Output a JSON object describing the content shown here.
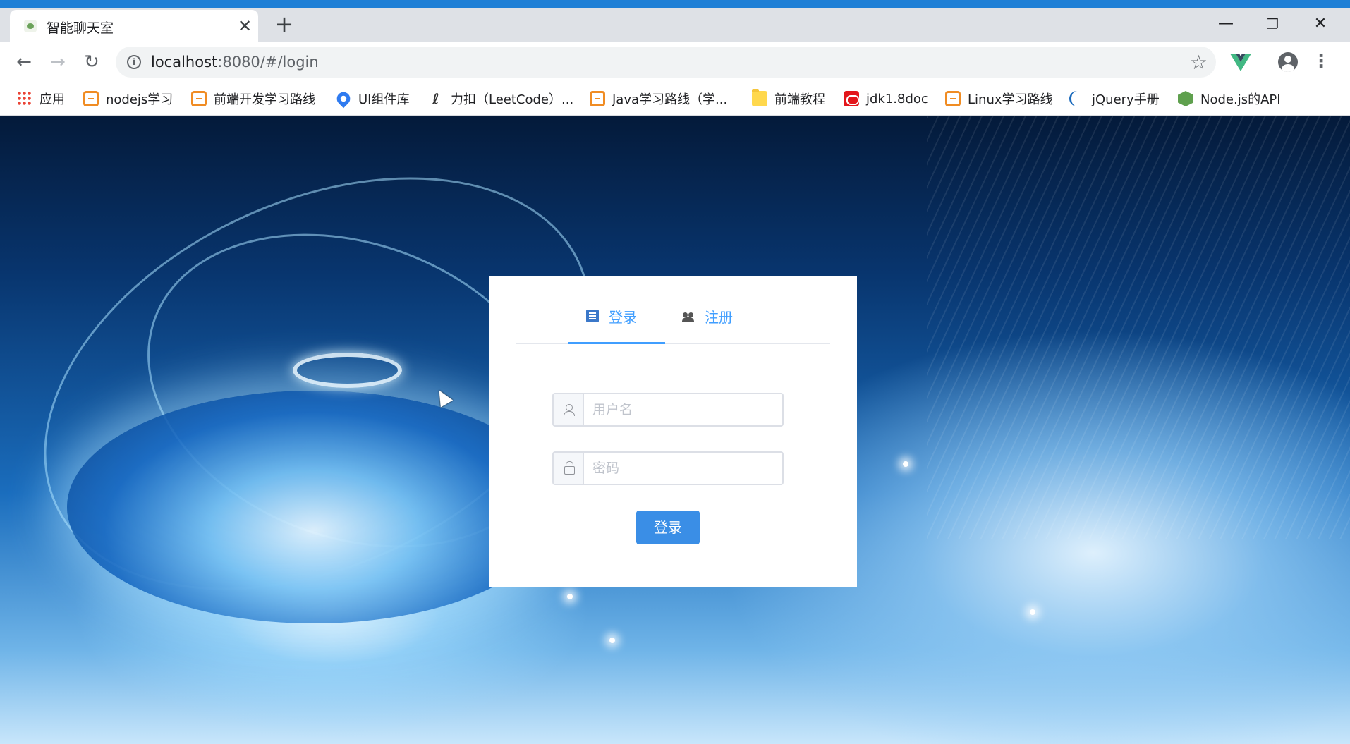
{
  "browser": {
    "tab_title": "智能聊天室",
    "tab_close": "✕",
    "new_tab": "+",
    "window_minimize": "—",
    "window_restore": "❐",
    "window_close": "✕",
    "url_host": "localhost",
    "url_rest": ":8080/#/login",
    "accent_color": "#1e7fd6"
  },
  "bookmarks": [
    {
      "label": "应用",
      "icon": "apps-grid-icon"
    },
    {
      "label": "nodejs学习",
      "icon": "csdn-icon"
    },
    {
      "label": "前端开发学习路线",
      "icon": "csdn-icon"
    },
    {
      "label": "UI组件库",
      "icon": "element-ui-icon"
    },
    {
      "label": "力扣（LeetCode）...",
      "icon": "leetcode-icon"
    },
    {
      "label": "Java学习路线（学...",
      "icon": "csdn-icon"
    },
    {
      "label": "前端教程",
      "icon": "folder-icon"
    },
    {
      "label": "jdk1.8doc",
      "icon": "oracle-icon"
    },
    {
      "label": "Linux学习路线",
      "icon": "csdn-icon"
    },
    {
      "label": "jQuery手册",
      "icon": "jquery-icon"
    },
    {
      "label": "Node.js的API",
      "icon": "nodejs-icon"
    }
  ],
  "login": {
    "tabs": [
      {
        "label": "登录",
        "icon": "document-icon",
        "active": true
      },
      {
        "label": "注册",
        "icon": "users-icon",
        "active": false
      }
    ],
    "username_placeholder": "用户名",
    "username_value": "",
    "password_placeholder": "密码",
    "password_value": "",
    "submit_label": "登录",
    "primary_color": "#409eff"
  }
}
